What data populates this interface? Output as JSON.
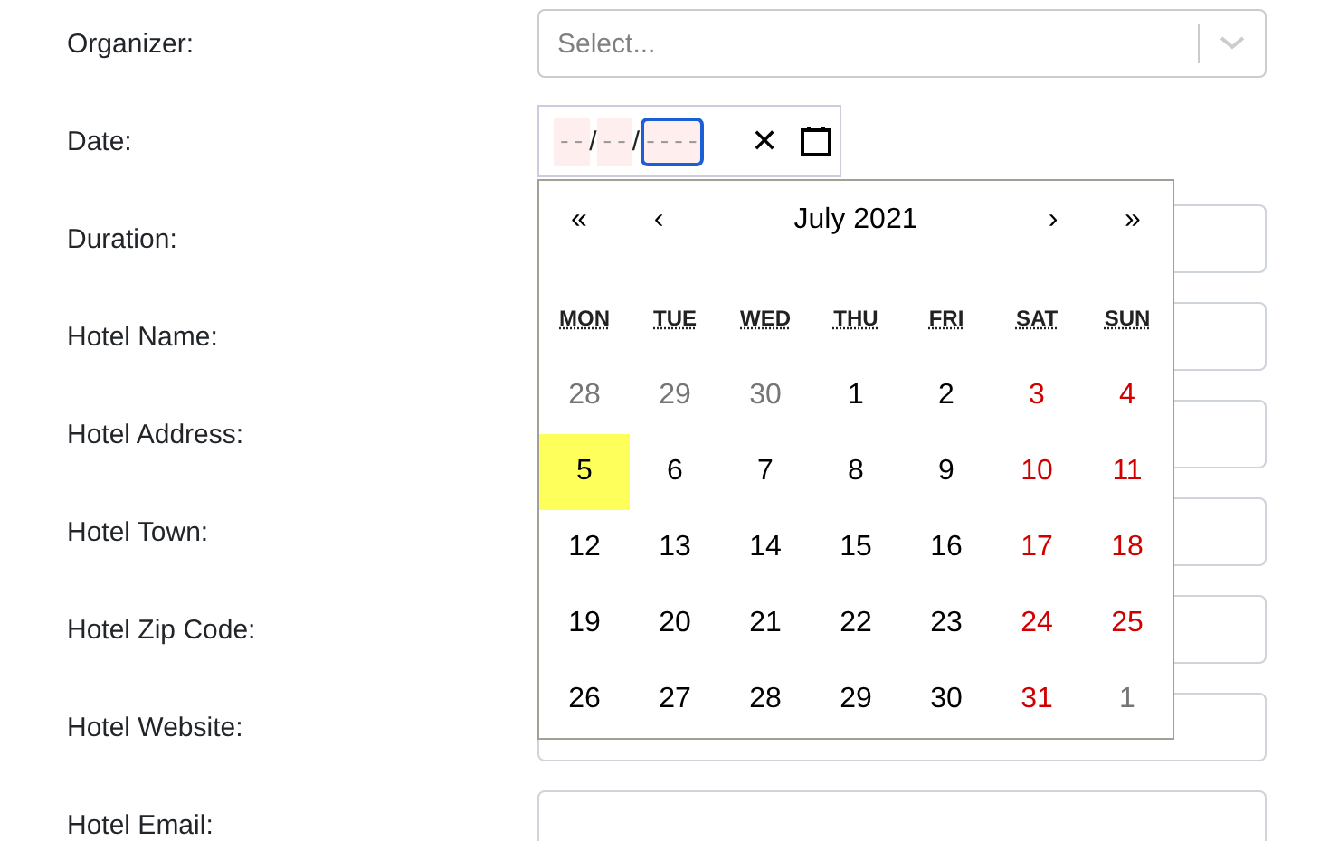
{
  "form": {
    "rows": [
      {
        "label": "Organizer:",
        "kind": "select",
        "placeholder": "Select..."
      },
      {
        "label": "Date:",
        "kind": "date",
        "segments": [
          {
            "placeholder": "--",
            "focused": false
          },
          {
            "placeholder": "--",
            "focused": false
          },
          {
            "placeholder": "----",
            "focused": true
          }
        ],
        "separators": [
          "/",
          "/"
        ],
        "clear": "✕"
      },
      {
        "label": "Duration:",
        "kind": "text"
      },
      {
        "label": "Hotel Name:",
        "kind": "text"
      },
      {
        "label": "Hotel Address:",
        "kind": "text"
      },
      {
        "label": "Hotel Town:",
        "kind": "text"
      },
      {
        "label": "Hotel Zip Code:",
        "kind": "text"
      },
      {
        "label": "Hotel Website:",
        "kind": "text"
      },
      {
        "label": "Hotel Email:",
        "kind": "text"
      }
    ]
  },
  "calendar": {
    "nav": {
      "prev_year": "«",
      "prev_month": "‹",
      "title": "July 2021",
      "next_month": "›",
      "next_year": "»"
    },
    "weekdays": [
      "MON",
      "TUE",
      "WED",
      "THU",
      "FRI",
      "SAT",
      "SUN"
    ],
    "weeks": [
      [
        {
          "day": "28",
          "kind": "neighbor",
          "selected": false
        },
        {
          "day": "29",
          "kind": "neighbor",
          "selected": false
        },
        {
          "day": "30",
          "kind": "neighbor",
          "selected": false
        },
        {
          "day": "1",
          "kind": "weekday",
          "selected": false
        },
        {
          "day": "2",
          "kind": "weekday",
          "selected": false
        },
        {
          "day": "3",
          "kind": "weekend",
          "selected": false
        },
        {
          "day": "4",
          "kind": "weekend",
          "selected": false
        }
      ],
      [
        {
          "day": "5",
          "kind": "weekday",
          "selected": true
        },
        {
          "day": "6",
          "kind": "weekday",
          "selected": false
        },
        {
          "day": "7",
          "kind": "weekday",
          "selected": false
        },
        {
          "day": "8",
          "kind": "weekday",
          "selected": false
        },
        {
          "day": "9",
          "kind": "weekday",
          "selected": false
        },
        {
          "day": "10",
          "kind": "weekend",
          "selected": false
        },
        {
          "day": "11",
          "kind": "weekend",
          "selected": false
        }
      ],
      [
        {
          "day": "12",
          "kind": "weekday",
          "selected": false
        },
        {
          "day": "13",
          "kind": "weekday",
          "selected": false
        },
        {
          "day": "14",
          "kind": "weekday",
          "selected": false
        },
        {
          "day": "15",
          "kind": "weekday",
          "selected": false
        },
        {
          "day": "16",
          "kind": "weekday",
          "selected": false
        },
        {
          "day": "17",
          "kind": "weekend",
          "selected": false
        },
        {
          "day": "18",
          "kind": "weekend",
          "selected": false
        }
      ],
      [
        {
          "day": "19",
          "kind": "weekday",
          "selected": false
        },
        {
          "day": "20",
          "kind": "weekday",
          "selected": false
        },
        {
          "day": "21",
          "kind": "weekday",
          "selected": false
        },
        {
          "day": "22",
          "kind": "weekday",
          "selected": false
        },
        {
          "day": "23",
          "kind": "weekday",
          "selected": false
        },
        {
          "day": "24",
          "kind": "weekend",
          "selected": false
        },
        {
          "day": "25",
          "kind": "weekend",
          "selected": false
        }
      ],
      [
        {
          "day": "26",
          "kind": "weekday",
          "selected": false
        },
        {
          "day": "27",
          "kind": "weekday",
          "selected": false
        },
        {
          "day": "28",
          "kind": "weekday",
          "selected": false
        },
        {
          "day": "29",
          "kind": "weekday",
          "selected": false
        },
        {
          "day": "30",
          "kind": "weekday",
          "selected": false
        },
        {
          "day": "31",
          "kind": "weekend",
          "selected": false
        },
        {
          "day": "1",
          "kind": "neighbor",
          "selected": false
        }
      ]
    ]
  }
}
